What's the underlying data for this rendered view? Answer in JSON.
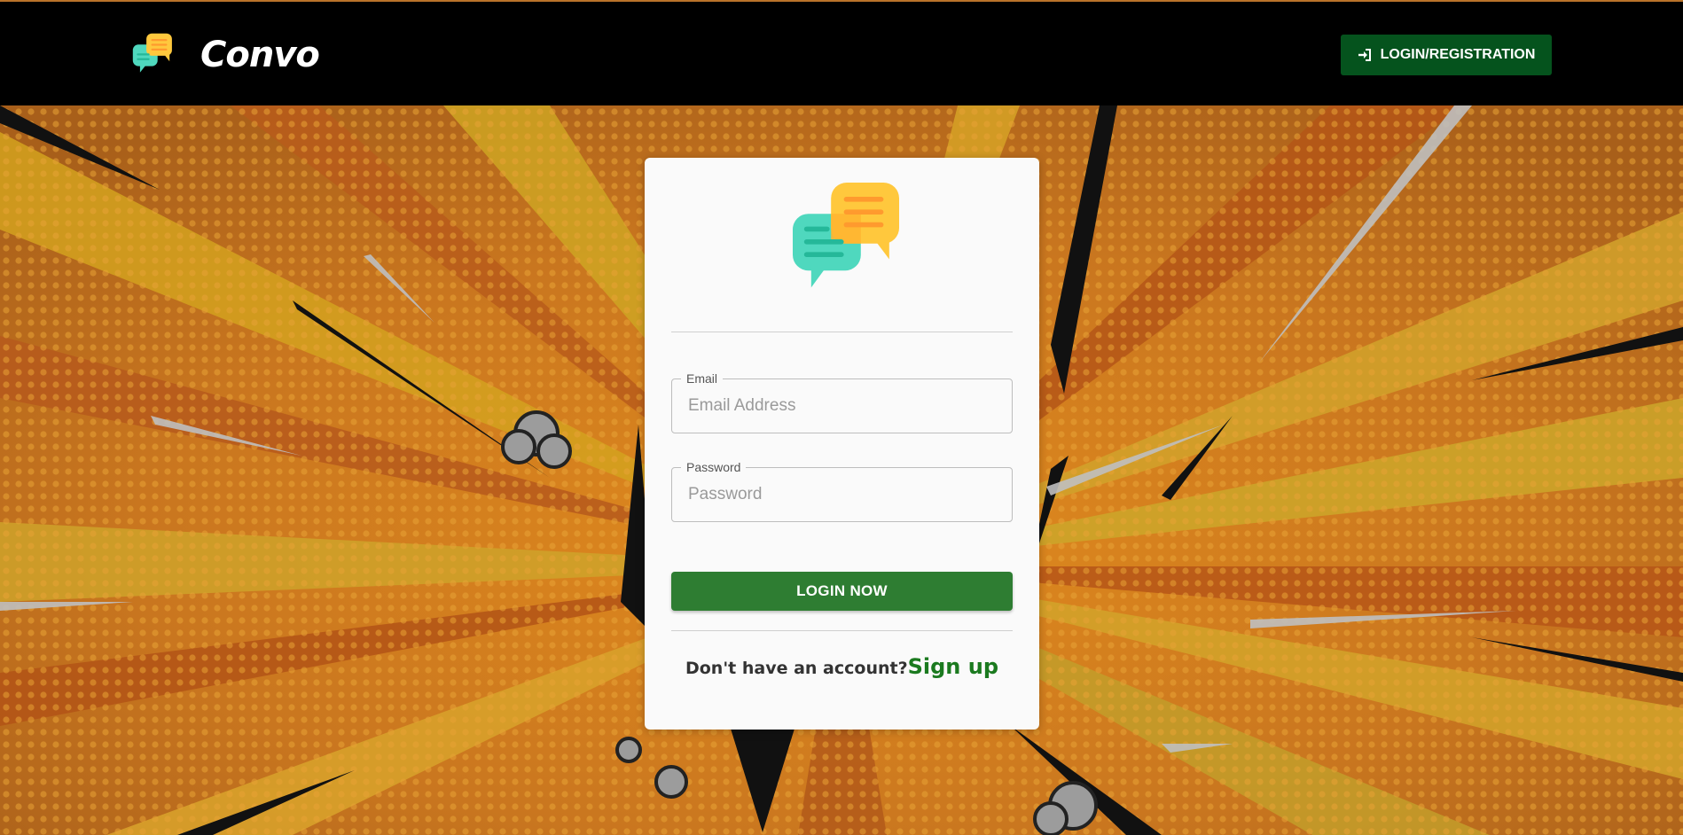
{
  "navbar": {
    "brand_name": "Convo",
    "login_button_label": "LOGIN/REGISTRATION"
  },
  "login_form": {
    "email_label": "Email",
    "email_placeholder": "Email Address",
    "email_value": "",
    "password_label": "Password",
    "password_placeholder": "Password",
    "password_value": "",
    "submit_label": "LOGIN NOW",
    "signup_prompt": "Don't have an account?",
    "signup_link": "Sign up"
  },
  "icons": {
    "brand_logo": "chat-bubbles-icon",
    "login_icon": "sign-in-icon",
    "card_logo": "chat-bubbles-icon"
  },
  "colors": {
    "navbar_bg": "#000000",
    "nav_button": "#05531d",
    "submit_button": "#2e7d32",
    "signup_link": "#1b7a1f",
    "bubble_teal": "#4fd8be",
    "bubble_yellow": "#ffc83d",
    "background_orange": "#c9761f"
  }
}
